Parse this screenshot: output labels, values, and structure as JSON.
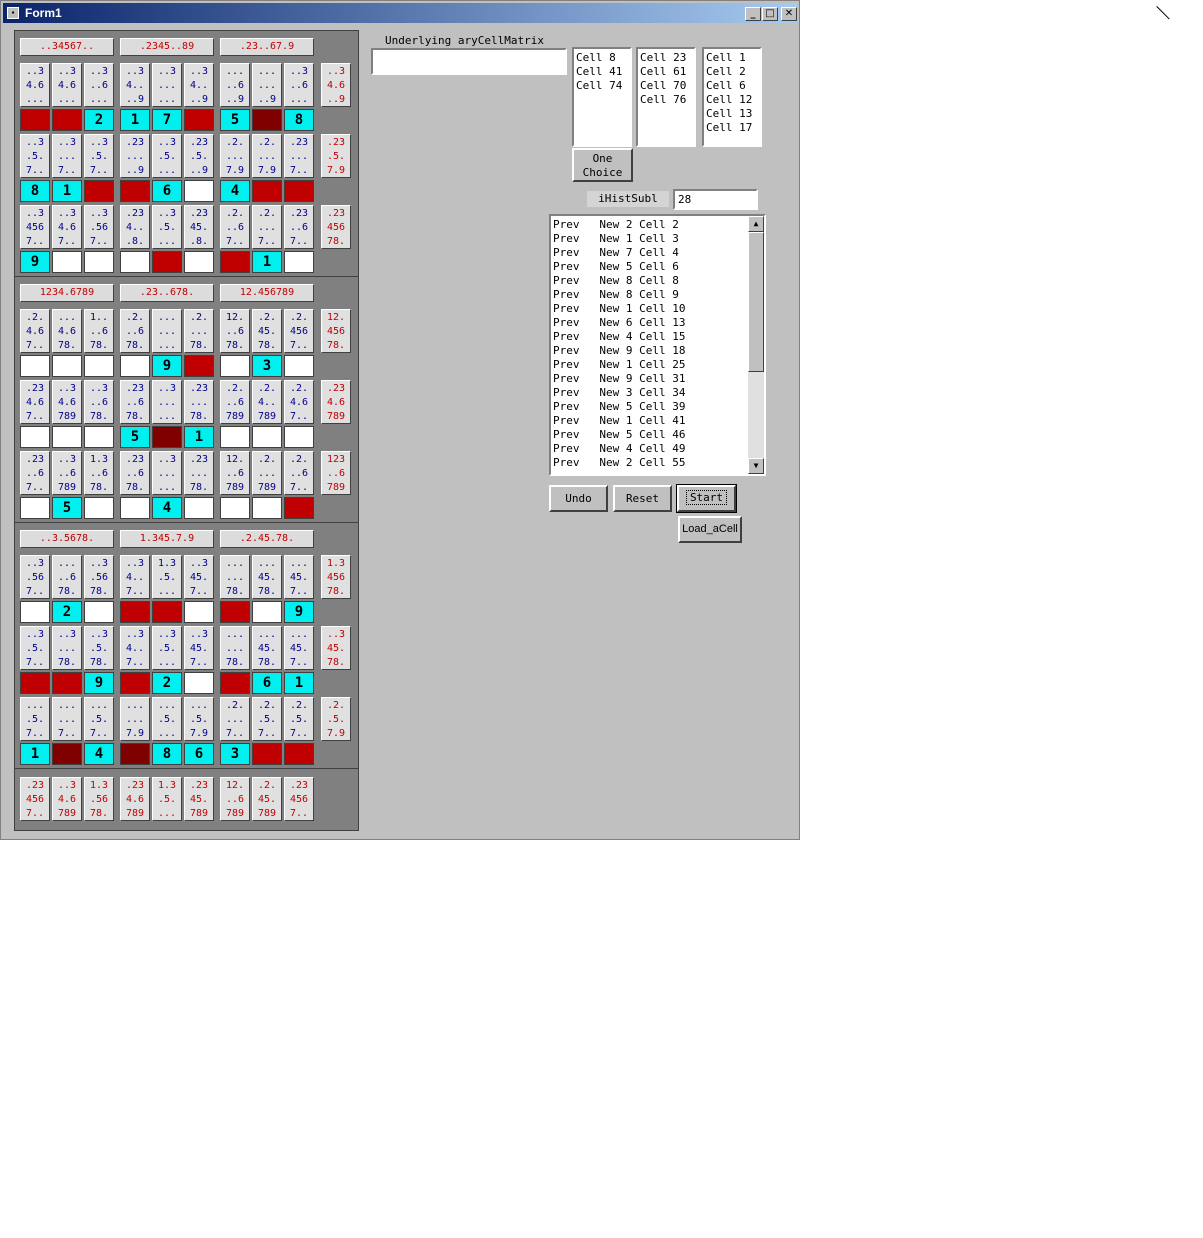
{
  "window": {
    "title": "Form1"
  },
  "title_buttons": {
    "minimize": "_",
    "maximize": "□",
    "close": "✕"
  },
  "colors": {
    "given_cyan": "#00f0f0",
    "error_red": "#c00000",
    "current_dark": "#800000",
    "candidate_blue": "#00008b"
  },
  "box_headers": [
    "..34567..",
    ".2345..89",
    ".23..67.9",
    "1234.6789",
    ".23..678.",
    "12.456789",
    "..3.5678.",
    "1.345.7.9",
    ".2.45.78."
  ],
  "row_candidates": [
    "..3\n4.6\n..9",
    ".23\n.5.\n7.9",
    ".23\n456\n78.",
    "12.\n456\n78.",
    ".23\n4.6\n789",
    "123\n..6\n789",
    "1.3\n456\n78.",
    "..3\n45.\n78.",
    ".2.\n.5.\n7.9"
  ],
  "column_candidates": [
    ".23\n456\n7..",
    "..3\n4.6\n789",
    "1.3\n.56\n78.",
    ".23\n4.6\n789",
    "1.3\n.5.\n...",
    ".23\n45.\n789",
    "12.\n..6\n789",
    ".2.\n45.\n789",
    ".23\n456\n7.."
  ],
  "cells": [
    [
      {
        "c": "..3\n4.6\n...",
        "v": "",
        "s": "red"
      },
      {
        "c": "..3\n4.6\n...",
        "v": "",
        "s": "red"
      },
      {
        "c": "..3\n..6\n...",
        "v": "2",
        "s": "cyan"
      },
      {
        "c": "..3\n4..\n..9",
        "v": "1",
        "s": "cyan"
      },
      {
        "c": "..3\n...\n...",
        "v": "7",
        "s": "cyan"
      },
      {
        "c": "..3\n4..\n..9",
        "v": "",
        "s": "red"
      },
      {
        "c": "...\n..6\n..9",
        "v": "5",
        "s": "cyan"
      },
      {
        "c": "...\n...\n..9",
        "v": "",
        "s": "dark"
      },
      {
        "c": "..3\n..6\n...",
        "v": "8",
        "s": "cyan"
      }
    ],
    [
      {
        "c": "..3\n.5.\n7..",
        "v": "8",
        "s": "cyan"
      },
      {
        "c": "..3\n...\n7..",
        "v": "1",
        "s": "cyan"
      },
      {
        "c": "..3\n.5.\n7..",
        "v": "",
        "s": "red"
      },
      {
        "c": ".23\n...\n..9",
        "v": "",
        "s": "red"
      },
      {
        "c": "..3\n.5.\n...",
        "v": "6",
        "s": "cyan"
      },
      {
        "c": ".23\n.5.\n..9",
        "v": "",
        "s": "white"
      },
      {
        "c": ".2.\n...\n7.9",
        "v": "4",
        "s": "cyan"
      },
      {
        "c": ".2.\n...\n7.9",
        "v": "",
        "s": "red"
      },
      {
        "c": ".23\n...\n7..",
        "v": "",
        "s": "red"
      }
    ],
    [
      {
        "c": "..3\n456\n7..",
        "v": "9",
        "s": "cyan"
      },
      {
        "c": "..3\n4.6\n7..",
        "v": "",
        "s": "white"
      },
      {
        "c": "..3\n.56\n7..",
        "v": "",
        "s": "white"
      },
      {
        "c": ".23\n4..\n.8.",
        "v": "",
        "s": "white"
      },
      {
        "c": "..3\n.5.\n...",
        "v": "",
        "s": "red"
      },
      {
        "c": ".23\n45.\n.8.",
        "v": "",
        "s": "white"
      },
      {
        "c": ".2.\n..6\n7..",
        "v": "",
        "s": "red"
      },
      {
        "c": ".2.\n...\n7..",
        "v": "1",
        "s": "cyan"
      },
      {
        "c": ".23\n..6\n7..",
        "v": "",
        "s": "white"
      }
    ],
    [
      {
        "c": ".2.\n4.6\n7..",
        "v": "",
        "s": "white"
      },
      {
        "c": "...\n4.6\n78.",
        "v": "",
        "s": "white"
      },
      {
        "c": "1..\n..6\n78.",
        "v": "",
        "s": "white"
      },
      {
        "c": ".2.\n..6\n78.",
        "v": "",
        "s": "white"
      },
      {
        "c": "...\n...\n...",
        "v": "9",
        "s": "cyan"
      },
      {
        "c": ".2.\n...\n78.",
        "v": "",
        "s": "red"
      },
      {
        "c": "12.\n..6\n78.",
        "v": "",
        "s": "white"
      },
      {
        "c": ".2.\n45.\n78.",
        "v": "3",
        "s": "cyan"
      },
      {
        "c": ".2.\n456\n7..",
        "v": "",
        "s": "white"
      }
    ],
    [
      {
        "c": ".23\n4.6\n7..",
        "v": "",
        "s": "white"
      },
      {
        "c": "..3\n4.6\n789",
        "v": "",
        "s": "white"
      },
      {
        "c": "..3\n..6\n78.",
        "v": "",
        "s": "white"
      },
      {
        "c": ".23\n..6\n78.",
        "v": "5",
        "s": "cyan"
      },
      {
        "c": "..3\n...\n...",
        "v": "",
        "s": "dark"
      },
      {
        "c": ".23\n...\n78.",
        "v": "1",
        "s": "cyan"
      },
      {
        "c": ".2.\n..6\n789",
        "v": "",
        "s": "white"
      },
      {
        "c": ".2.\n4..\n789",
        "v": "",
        "s": "white"
      },
      {
        "c": ".2.\n4.6\n7..",
        "v": "",
        "s": "white"
      }
    ],
    [
      {
        "c": ".23\n..6\n7..",
        "v": "",
        "s": "white"
      },
      {
        "c": "..3\n..6\n789",
        "v": "5",
        "s": "cyan"
      },
      {
        "c": "1.3\n..6\n78.",
        "v": "",
        "s": "white"
      },
      {
        "c": ".23\n..6\n78.",
        "v": "",
        "s": "white"
      },
      {
        "c": "..3\n...\n...",
        "v": "4",
        "s": "cyan"
      },
      {
        "c": ".23\n...\n78.",
        "v": "",
        "s": "white"
      },
      {
        "c": "12.\n..6\n789",
        "v": "",
        "s": "white"
      },
      {
        "c": ".2.\n...\n789",
        "v": "",
        "s": "white"
      },
      {
        "c": ".2.\n..6\n7..",
        "v": "",
        "s": "red"
      }
    ],
    [
      {
        "c": "..3\n.56\n7..",
        "v": "",
        "s": "white"
      },
      {
        "c": "...\n..6\n78.",
        "v": "2",
        "s": "cyan"
      },
      {
        "c": "..3\n.56\n78.",
        "v": "",
        "s": "white"
      },
      {
        "c": "..3\n4..\n7..",
        "v": "",
        "s": "red"
      },
      {
        "c": "1.3\n.5.\n...",
        "v": "",
        "s": "red"
      },
      {
        "c": "..3\n45.\n7..",
        "v": "",
        "s": "white"
      },
      {
        "c": "...\n...\n78.",
        "v": "",
        "s": "red"
      },
      {
        "c": "...\n45.\n78.",
        "v": "",
        "s": "white"
      },
      {
        "c": "...\n45.\n7..",
        "v": "9",
        "s": "cyan"
      }
    ],
    [
      {
        "c": "..3\n.5.\n7..",
        "v": "",
        "s": "red"
      },
      {
        "c": "..3\n...\n78.",
        "v": "",
        "s": "red"
      },
      {
        "c": "..3\n.5.\n78.",
        "v": "9",
        "s": "cyan"
      },
      {
        "c": "..3\n4..\n7..",
        "v": "",
        "s": "red"
      },
      {
        "c": "..3\n.5.\n...",
        "v": "2",
        "s": "cyan"
      },
      {
        "c": "..3\n45.\n7..",
        "v": "",
        "s": "white"
      },
      {
        "c": "...\n...\n78.",
        "v": "",
        "s": "red"
      },
      {
        "c": "...\n45.\n78.",
        "v": "6",
        "s": "cyan"
      },
      {
        "c": "...\n45.\n7..",
        "v": "1",
        "s": "cyan"
      }
    ],
    [
      {
        "c": "...\n.5.\n7..",
        "v": "1",
        "s": "cyan"
      },
      {
        "c": "...\n...\n7..",
        "v": "",
        "s": "dark"
      },
      {
        "c": "...\n.5.\n7..",
        "v": "4",
        "s": "cyan"
      },
      {
        "c": "...\n...\n7.9",
        "v": "",
        "s": "dark"
      },
      {
        "c": "...\n.5.\n...",
        "v": "8",
        "s": "cyan"
      },
      {
        "c": "...\n.5.\n7.9",
        "v": "6",
        "s": "cyan"
      },
      {
        "c": ".2.\n...\n7..",
        "v": "3",
        "s": "cyan"
      },
      {
        "c": ".2.\n.5.\n7..",
        "v": "",
        "s": "red"
      },
      {
        "c": ".2.\n.5.\n7..",
        "v": "",
        "s": "red"
      }
    ]
  ],
  "matrix": {
    "label": "Underlying aryCellMatrix",
    "value": ""
  },
  "list1": [
    "Cell 8",
    "Cell 41",
    "Cell 74"
  ],
  "list2": [
    "Cell 23",
    "Cell 61",
    "Cell 70",
    "Cell 76"
  ],
  "list3": [
    "Cell 1",
    "Cell 2",
    "Cell 6",
    "Cell 12",
    "Cell 13",
    "Cell 17"
  ],
  "one_choice_label": "One Choice",
  "hist": {
    "label": "iHistSubl",
    "value": "28"
  },
  "history": [
    "Prev   New 2 Cell 2",
    "Prev   New 1 Cell 3",
    "Prev   New 7 Cell 4",
    "Prev   New 5 Cell 6",
    "Prev   New 8 Cell 8",
    "Prev   New 8 Cell 9",
    "Prev   New 1 Cell 10",
    "Prev   New 6 Cell 13",
    "Prev   New 4 Cell 15",
    "Prev   New 9 Cell 18",
    "Prev   New 1 Cell 25",
    "Prev   New 9 Cell 31",
    "Prev   New 3 Cell 34",
    "Prev   New 5 Cell 39",
    "Prev   New 1 Cell 41",
    "Prev   New 5 Cell 46",
    "Prev   New 4 Cell 49",
    "Prev   New 2 Cell 55"
  ],
  "scroll_icons": {
    "up": "▲",
    "down": "▼"
  },
  "buttons": {
    "undo": "Undo",
    "reset": "Reset",
    "start": "Start",
    "load": "Load_aCell"
  }
}
